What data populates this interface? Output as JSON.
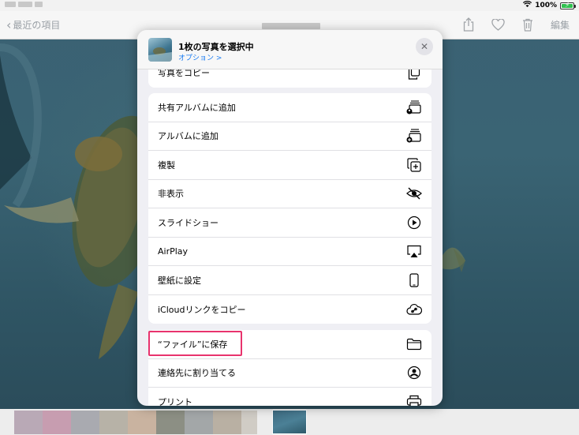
{
  "status_bar": {
    "battery_percent": "100%"
  },
  "nav": {
    "back_label": "最近の項目",
    "edit_label": "編集"
  },
  "sheet": {
    "title": "1枚の写真を選択中",
    "options_label": "オプション >",
    "close_symbol": "✕",
    "group1": [
      {
        "label": "写真をコピー",
        "icon": "copy-icon"
      }
    ],
    "group2": [
      {
        "label": "共有アルバムに追加",
        "icon": "shared-album-icon"
      },
      {
        "label": "アルバムに追加",
        "icon": "add-album-icon"
      },
      {
        "label": "複製",
        "icon": "duplicate-icon"
      },
      {
        "label": "非表示",
        "icon": "hide-icon"
      },
      {
        "label": "スライドショー",
        "icon": "play-icon"
      },
      {
        "label": "AirPlay",
        "icon": "airplay-icon"
      },
      {
        "label": "壁紙に設定",
        "icon": "phone-icon"
      },
      {
        "label": "iCloudリンクをコピー",
        "icon": "cloud-link-icon"
      }
    ],
    "group3": [
      {
        "label": "“ファイル”に保存",
        "icon": "folder-icon"
      },
      {
        "label": "連絡先に割り当てる",
        "icon": "contact-icon"
      },
      {
        "label": "プリント",
        "icon": "print-icon"
      }
    ]
  },
  "colors": {
    "highlight": "#e8336d",
    "link_blue": "#1a7cf2",
    "battery_green": "#30c04f"
  }
}
